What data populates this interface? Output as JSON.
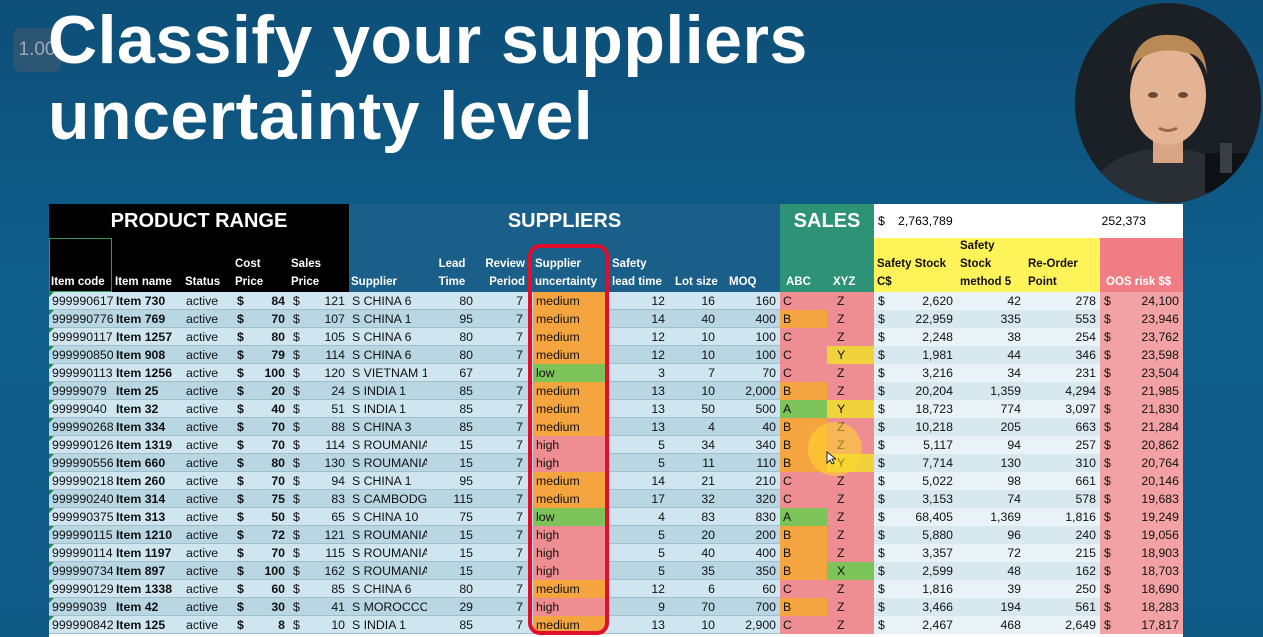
{
  "overlay": {
    "playback_speed": "1.00"
  },
  "title": {
    "line1": "Classify your suppliers",
    "line2": "uncertainty level"
  },
  "sections": {
    "product_range": "PRODUCT RANGE",
    "suppliers": "SUPPLIERS",
    "sales": "SALES"
  },
  "totals": {
    "currency": "$",
    "safety_stock_total": "2,763,789",
    "reorder_total": "252,373"
  },
  "headers": {
    "item_code": "Item code",
    "item_name": "Item name",
    "status": "Status",
    "cost_price": [
      "Cost",
      "Price"
    ],
    "sales_price": [
      "Sales",
      "Price"
    ],
    "supplier": "Supplier",
    "lead_time": [
      "Lead",
      "Time"
    ],
    "review_period": [
      "Review",
      "Period"
    ],
    "supplier_uncertainty": [
      "Supplier",
      "uncertainty"
    ],
    "safety_lead_time": [
      "Safety",
      "lead time"
    ],
    "lot_size": "Lot size",
    "moq": "MOQ",
    "abc": "ABC",
    "xyz": "XYZ",
    "safety_stock": [
      "Safety Stock",
      "C$"
    ],
    "safety_stock_m5": [
      "Safety",
      "Stock",
      "method 5"
    ],
    "reorder_point": [
      "Re-Order",
      "Point"
    ],
    "oos_risk": "OOS risk $$"
  },
  "colors": {
    "high": "#ee8e92",
    "medium": "#f5a540",
    "low": "#7cc35a",
    "abc_a": "#7cc35a",
    "abc_b": "#f5a540",
    "abc_c": "#ee8e92",
    "xyz_x": "#7cc35a",
    "xyz_y": "#f0d23c",
    "xyz_z": "#ee8e92",
    "header_yellow": "#fff35a",
    "header_pink": "#f07d84",
    "suppliers_blue": "#1a5f8a",
    "sales_green": "#2e9276"
  },
  "rows": [
    {
      "code": "999990617",
      "name": "Item 730",
      "status": "active",
      "cost": "84",
      "sales": "121",
      "supplier": "S CHINA 6",
      "lead": "80",
      "review": "7",
      "unc": "medium",
      "slt": "12",
      "lot": "16",
      "moq": "160",
      "abc": "C",
      "xyz": "Z",
      "ss": "2,620",
      "ssm5": "42",
      "rop": "278",
      "oos": "24,100"
    },
    {
      "code": "999990776",
      "name": "Item 769",
      "status": "active",
      "cost": "70",
      "sales": "107",
      "supplier": "S CHINA 1",
      "lead": "95",
      "review": "7",
      "unc": "medium",
      "slt": "14",
      "lot": "40",
      "moq": "400",
      "abc": "B",
      "xyz": "Z",
      "ss": "22,959",
      "ssm5": "335",
      "rop": "553",
      "oos": "23,946"
    },
    {
      "code": "999990117",
      "name": "Item 1257",
      "status": "active",
      "cost": "80",
      "sales": "105",
      "supplier": "S CHINA 6",
      "lead": "80",
      "review": "7",
      "unc": "medium",
      "slt": "12",
      "lot": "10",
      "moq": "100",
      "abc": "C",
      "xyz": "Z",
      "ss": "2,248",
      "ssm5": "38",
      "rop": "254",
      "oos": "23,762"
    },
    {
      "code": "999990850",
      "name": "Item 908",
      "status": "active",
      "cost": "79",
      "sales": "114",
      "supplier": "S CHINA 6",
      "lead": "80",
      "review": "7",
      "unc": "medium",
      "slt": "12",
      "lot": "10",
      "moq": "100",
      "abc": "C",
      "xyz": "Y",
      "ss": "1,981",
      "ssm5": "44",
      "rop": "346",
      "oos": "23,598"
    },
    {
      "code": "999990113",
      "name": "Item 1256",
      "status": "active",
      "cost": "100",
      "sales": "120",
      "supplier": "S VIETNAM 1",
      "lead": "67",
      "review": "7",
      "unc": "low",
      "slt": "3",
      "lot": "7",
      "moq": "70",
      "abc": "C",
      "xyz": "Z",
      "ss": "3,216",
      "ssm5": "34",
      "rop": "231",
      "oos": "23,504"
    },
    {
      "code": "99999079",
      "name": "Item 25",
      "status": "active",
      "cost": "20",
      "sales": "24",
      "supplier": "S INDIA 1",
      "lead": "85",
      "review": "7",
      "unc": "medium",
      "slt": "13",
      "lot": "10",
      "moq": "2,000",
      "abc": "B",
      "xyz": "Z",
      "ss": "20,204",
      "ssm5": "1,359",
      "rop": "4,294",
      "oos": "21,985"
    },
    {
      "code": "99999040",
      "name": "Item 32",
      "status": "active",
      "cost": "40",
      "sales": "51",
      "supplier": "S INDIA 1",
      "lead": "85",
      "review": "7",
      "unc": "medium",
      "slt": "13",
      "lot": "50",
      "moq": "500",
      "abc": "A",
      "xyz": "Y",
      "ss": "18,723",
      "ssm5": "774",
      "rop": "3,097",
      "oos": "21,830"
    },
    {
      "code": "999990268",
      "name": "Item 334",
      "status": "active",
      "cost": "70",
      "sales": "88",
      "supplier": "S CHINA 3",
      "lead": "85",
      "review": "7",
      "unc": "medium",
      "slt": "13",
      "lot": "4",
      "moq": "40",
      "abc": "B",
      "xyz": "Z",
      "ss": "10,218",
      "ssm5": "205",
      "rop": "663",
      "oos": "21,284"
    },
    {
      "code": "999990126",
      "name": "Item 1319",
      "status": "active",
      "cost": "70",
      "sales": "114",
      "supplier": "S ROUMANIA",
      "lead": "15",
      "review": "7",
      "unc": "high",
      "slt": "5",
      "lot": "34",
      "moq": "340",
      "abc": "B",
      "xyz": "Z",
      "ss": "5,117",
      "ssm5": "94",
      "rop": "257",
      "oos": "20,862"
    },
    {
      "code": "999990556",
      "name": "Item 660",
      "status": "active",
      "cost": "80",
      "sales": "130",
      "supplier": "S ROUMANIA",
      "lead": "15",
      "review": "7",
      "unc": "high",
      "slt": "5",
      "lot": "11",
      "moq": "110",
      "abc": "B",
      "xyz": "Y",
      "ss": "7,714",
      "ssm5": "130",
      "rop": "310",
      "oos": "20,764"
    },
    {
      "code": "999990218",
      "name": "Item 260",
      "status": "active",
      "cost": "70",
      "sales": "94",
      "supplier": "S CHINA 1",
      "lead": "95",
      "review": "7",
      "unc": "medium",
      "slt": "14",
      "lot": "21",
      "moq": "210",
      "abc": "C",
      "xyz": "Z",
      "ss": "5,022",
      "ssm5": "98",
      "rop": "661",
      "oos": "20,146"
    },
    {
      "code": "999990240",
      "name": "Item 314",
      "status": "active",
      "cost": "75",
      "sales": "83",
      "supplier": "S CAMBODGI",
      "lead": "115",
      "review": "7",
      "unc": "medium",
      "slt": "17",
      "lot": "32",
      "moq": "320",
      "abc": "C",
      "xyz": "Z",
      "ss": "3,153",
      "ssm5": "74",
      "rop": "578",
      "oos": "19,683"
    },
    {
      "code": "999990375",
      "name": "Item 313",
      "status": "active",
      "cost": "50",
      "sales": "65",
      "supplier": "S CHINA 10",
      "lead": "75",
      "review": "7",
      "unc": "low",
      "slt": "4",
      "lot": "83",
      "moq": "830",
      "abc": "A",
      "xyz": "Z",
      "ss": "68,405",
      "ssm5": "1,369",
      "rop": "1,816",
      "oos": "19,249"
    },
    {
      "code": "999990115",
      "name": "Item 1210",
      "status": "active",
      "cost": "72",
      "sales": "121",
      "supplier": "S ROUMANIA",
      "lead": "15",
      "review": "7",
      "unc": "high",
      "slt": "5",
      "lot": "20",
      "moq": "200",
      "abc": "B",
      "xyz": "Z",
      "ss": "5,880",
      "ssm5": "96",
      "rop": "240",
      "oos": "19,056"
    },
    {
      "code": "999990114",
      "name": "Item 1197",
      "status": "active",
      "cost": "70",
      "sales": "115",
      "supplier": "S ROUMANIA",
      "lead": "15",
      "review": "7",
      "unc": "high",
      "slt": "5",
      "lot": "40",
      "moq": "400",
      "abc": "B",
      "xyz": "Z",
      "ss": "3,357",
      "ssm5": "72",
      "rop": "215",
      "oos": "18,903"
    },
    {
      "code": "999990734",
      "name": "Item 897",
      "status": "active",
      "cost": "100",
      "sales": "162",
      "supplier": "S ROUMANIA",
      "lead": "15",
      "review": "7",
      "unc": "high",
      "slt": "5",
      "lot": "35",
      "moq": "350",
      "abc": "B",
      "xyz": "X",
      "ss": "2,599",
      "ssm5": "48",
      "rop": "162",
      "oos": "18,703"
    },
    {
      "code": "999990129",
      "name": "Item 1338",
      "status": "active",
      "cost": "60",
      "sales": "85",
      "supplier": "S CHINA 6",
      "lead": "80",
      "review": "7",
      "unc": "medium",
      "slt": "12",
      "lot": "6",
      "moq": "60",
      "abc": "C",
      "xyz": "Z",
      "ss": "1,816",
      "ssm5": "39",
      "rop": "250",
      "oos": "18,690"
    },
    {
      "code": "99999039",
      "name": "Item 42",
      "status": "active",
      "cost": "30",
      "sales": "41",
      "supplier": "S MOROCCO",
      "lead": "29",
      "review": "7",
      "unc": "high",
      "slt": "9",
      "lot": "70",
      "moq": "700",
      "abc": "B",
      "xyz": "Z",
      "ss": "3,466",
      "ssm5": "194",
      "rop": "561",
      "oos": "18,283"
    },
    {
      "code": "999990842",
      "name": "Item 125",
      "status": "active",
      "cost": "8",
      "sales": "10",
      "supplier": "S INDIA 1",
      "lead": "85",
      "review": "7",
      "unc": "medium",
      "slt": "13",
      "lot": "10",
      "moq": "2,900",
      "abc": "C",
      "xyz": "Z",
      "ss": "2,467",
      "ssm5": "468",
      "rop": "2,649",
      "oos": "17,817"
    }
  ]
}
